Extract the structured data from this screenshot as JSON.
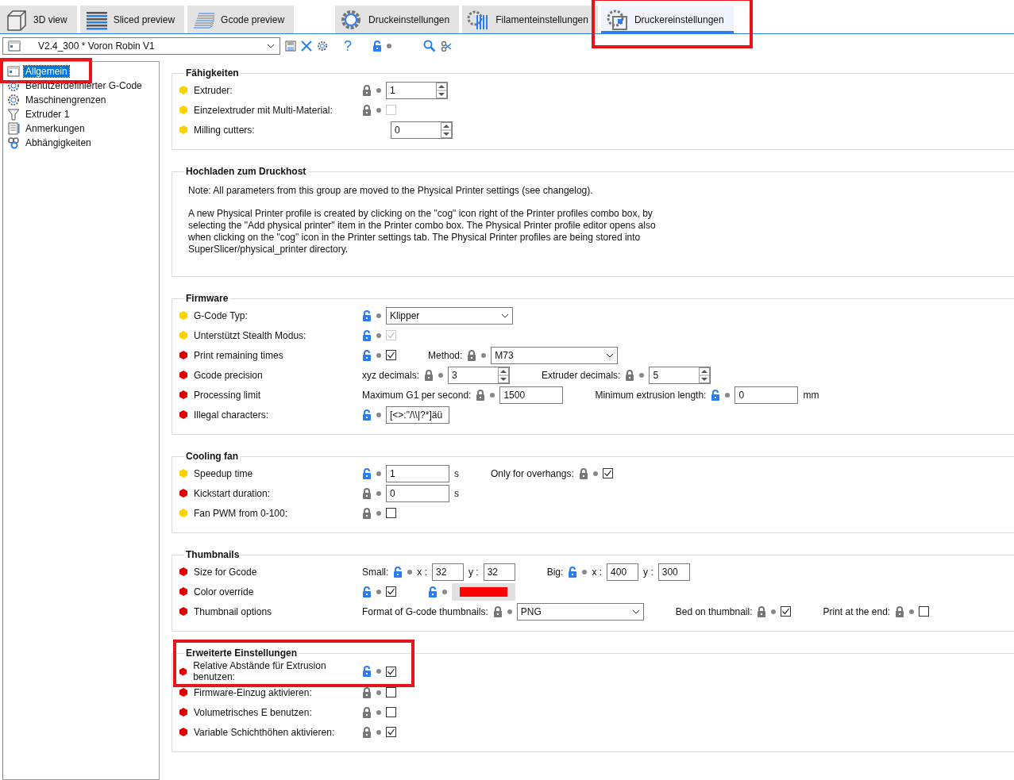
{
  "tabs": {
    "views": [
      {
        "label": "3D view",
        "selected": false
      },
      {
        "label": "Sliced preview",
        "selected": false
      },
      {
        "label": "Gcode preview",
        "selected": false
      }
    ],
    "settings": [
      {
        "label": "Druckeinstellungen",
        "selected": false,
        "highlighted": false
      },
      {
        "label": "Filamenteinstellungen",
        "selected": false,
        "highlighted": false
      },
      {
        "label": "Druckereinstellungen",
        "selected": true,
        "highlighted": true
      }
    ]
  },
  "toolbar": {
    "preset": "V2.4_300 * Voron Robin V1",
    "help": "?"
  },
  "sidebar": {
    "items": [
      {
        "label": "Allgemein",
        "selected": true,
        "highlighted": true
      },
      {
        "label": "Benutzerdefinierter G-Code",
        "selected": false,
        "highlighted": false
      },
      {
        "label": "Maschinengrenzen",
        "selected": false,
        "highlighted": false
      },
      {
        "label": "Extruder 1",
        "selected": false,
        "highlighted": false
      },
      {
        "label": "Anmerkungen",
        "selected": false,
        "highlighted": false
      },
      {
        "label": "Abhängigkeiten",
        "selected": false,
        "highlighted": false
      }
    ]
  },
  "sections": [
    {
      "title": "Fähigkeiten",
      "highlighted": false,
      "rows": [
        {
          "label": "Extruder:",
          "color": "#ffd200",
          "groups": [
            {
              "items": [
                {
                  "kind": "lock",
                  "locked": true
                },
                {
                  "kind": "spin",
                  "value": "1"
                }
              ]
            }
          ]
        },
        {
          "label": "Einzelextruder mit Multi-Material:",
          "color": "#ffd200",
          "groups": [
            {
              "items": [
                {
                  "kind": "lock",
                  "locked": true
                },
                {
                  "kind": "check",
                  "checked": false,
                  "disabled": true
                }
              ]
            }
          ]
        },
        {
          "label": "Milling cutters:",
          "color": "#ffd200",
          "groups": [
            {
              "items": [
                {
                  "kind": "spin",
                  "value": "0"
                }
              ]
            }
          ]
        }
      ]
    },
    {
      "title": "Hochladen zum Druckhost",
      "highlighted": false,
      "paragraphs": [
        "Note: All parameters from this group are moved to the Physical Printer settings (see changelog).",
        "A new Physical Printer profile is created by clicking on the \"cog\" icon right of the Printer profiles combo box, by selecting the \"Add physical printer\" item in the Printer combo box. The Physical Printer profile editor opens also when clicking on the \"cog\" icon in the Printer settings tab. The Physical Printer profiles are being stored into SuperSlicer/physical_printer directory."
      ]
    },
    {
      "title": "Firmware",
      "highlighted": false,
      "rows": [
        {
          "label": "G-Code Typ:",
          "color": "#ffd200",
          "groups": [
            {
              "items": [
                {
                  "kind": "lock",
                  "locked": false
                },
                {
                  "kind": "combo",
                  "value": "Klipper"
                }
              ]
            }
          ]
        },
        {
          "label": "Unterstützt Stealth Modus:",
          "color": "#ffd200",
          "groups": [
            {
              "items": [
                {
                  "kind": "lock",
                  "locked": false
                },
                {
                  "kind": "check",
                  "checked": true,
                  "disabled": true
                }
              ]
            }
          ]
        },
        {
          "label": "Print remaining times",
          "color": "#e00000",
          "groups": [
            {
              "items": [
                {
                  "kind": "lock",
                  "locked": false
                },
                {
                  "kind": "check",
                  "checked": true,
                  "disabled": false
                }
              ]
            },
            {
              "items": [
                {
                  "kind": "label",
                  "text": "Method:"
                },
                {
                  "kind": "lock",
                  "locked": true
                },
                {
                  "kind": "combo",
                  "value": "M73"
                }
              ]
            }
          ]
        },
        {
          "label": "Gcode precision",
          "color": "#e00000",
          "groups": [
            {
              "items": [
                {
                  "kind": "label",
                  "text": "xyz decimals:"
                },
                {
                  "kind": "lock",
                  "locked": true
                },
                {
                  "kind": "spin",
                  "value": "3"
                }
              ]
            },
            {
              "items": [
                {
                  "kind": "label",
                  "text": "Extruder decimals:"
                },
                {
                  "kind": "lock",
                  "locked": true
                },
                {
                  "kind": "spin",
                  "value": "5"
                }
              ]
            }
          ]
        },
        {
          "label": "Processing limit",
          "color": "#e00000",
          "groups": [
            {
              "items": [
                {
                  "kind": "label",
                  "text": "Maximum G1 per second:"
                },
                {
                  "kind": "lock",
                  "locked": true
                },
                {
                  "kind": "text",
                  "value": "1500"
                }
              ]
            },
            {
              "items": [
                {
                  "kind": "label",
                  "text": "Minimum extrusion length:"
                },
                {
                  "kind": "lock",
                  "locked": false
                },
                {
                  "kind": "text",
                  "value": "0"
                },
                {
                  "kind": "unit",
                  "text": "mm"
                }
              ]
            }
          ]
        },
        {
          "label": "Illegal characters:",
          "color": "#e00000",
          "groups": [
            {
              "items": [
                {
                  "kind": "lock",
                  "locked": false
                },
                {
                  "kind": "text",
                  "value": "[<>:\"/\\\\|?*]äü"
                }
              ]
            }
          ]
        }
      ]
    },
    {
      "title": "Cooling fan",
      "highlighted": false,
      "rows": [
        {
          "label": "Speedup time",
          "color": "#ffd200",
          "groups": [
            {
              "items": [
                {
                  "kind": "lock",
                  "locked": false
                },
                {
                  "kind": "text",
                  "value": "1"
                },
                {
                  "kind": "unit",
                  "text": "s"
                }
              ]
            },
            {
              "items": [
                {
                  "kind": "label",
                  "text": "Only for overhangs:"
                },
                {
                  "kind": "lock",
                  "locked": true
                },
                {
                  "kind": "check",
                  "checked": true,
                  "disabled": false
                }
              ]
            }
          ]
        },
        {
          "label": "Kickstart duration:",
          "color": "#e00000",
          "groups": [
            {
              "items": [
                {
                  "kind": "lock",
                  "locked": true
                },
                {
                  "kind": "text",
                  "value": "0"
                },
                {
                  "kind": "unit",
                  "text": "s"
                }
              ]
            }
          ]
        },
        {
          "label": "Fan PWM from 0-100:",
          "color": "#ffd200",
          "groups": [
            {
              "items": [
                {
                  "kind": "lock",
                  "locked": true
                },
                {
                  "kind": "check",
                  "checked": false,
                  "disabled": false
                }
              ]
            }
          ]
        }
      ]
    },
    {
      "title": "Thumbnails",
      "highlighted": false,
      "rows": [
        {
          "label": "Size for Gcode",
          "color": "#e00000",
          "groups": [
            {
              "items": [
                {
                  "kind": "label",
                  "text": "Small:"
                },
                {
                  "kind": "lock",
                  "locked": false
                },
                {
                  "kind": "label",
                  "text": "x :"
                },
                {
                  "kind": "short",
                  "value": "32"
                },
                {
                  "kind": "label",
                  "text": "y :"
                },
                {
                  "kind": "short",
                  "value": "32"
                }
              ]
            },
            {
              "items": [
                {
                  "kind": "label",
                  "text": "Big:"
                },
                {
                  "kind": "lock",
                  "locked": false
                },
                {
                  "kind": "label",
                  "text": "x :"
                },
                {
                  "kind": "short",
                  "value": "400"
                },
                {
                  "kind": "label",
                  "text": "y :"
                },
                {
                  "kind": "short",
                  "value": "300"
                }
              ]
            }
          ]
        },
        {
          "label": "Color override",
          "color": "#e00000",
          "groups": [
            {
              "items": [
                {
                  "kind": "lock",
                  "locked": false
                },
                {
                  "kind": "check",
                  "checked": true,
                  "disabled": false
                }
              ]
            },
            {
              "items": [
                {
                  "kind": "lock",
                  "locked": false
                },
                {
                  "kind": "swatch",
                  "color": "#ff0000"
                }
              ]
            }
          ]
        },
        {
          "label": "Thumbnail options",
          "color": "#e00000",
          "groups": [
            {
              "items": [
                {
                  "kind": "label",
                  "text": "Format of G-code thumbnails:"
                },
                {
                  "kind": "lock",
                  "locked": true
                },
                {
                  "kind": "combo",
                  "value": "PNG"
                }
              ]
            },
            {
              "items": [
                {
                  "kind": "label",
                  "text": "Bed on thumbnail:"
                },
                {
                  "kind": "lock",
                  "locked": true
                },
                {
                  "kind": "check",
                  "checked": true,
                  "disabled": false
                }
              ]
            },
            {
              "items": [
                {
                  "kind": "label",
                  "text": "Print at the end:"
                },
                {
                  "kind": "lock",
                  "locked": true
                },
                {
                  "kind": "check",
                  "checked": false,
                  "disabled": false
                }
              ]
            }
          ]
        }
      ]
    },
    {
      "title": "Erweiterte Einstellungen",
      "highlighted": true,
      "rows": [
        {
          "label": "Relative Abstände für Extrusion benutzen:",
          "color": "#e00000",
          "groups": [
            {
              "items": [
                {
                  "kind": "lock",
                  "locked": false
                },
                {
                  "kind": "check",
                  "checked": true,
                  "disabled": false
                }
              ]
            }
          ]
        },
        {
          "label": "Firmware-Einzug aktivieren:",
          "color": "#e00000",
          "groups": [
            {
              "items": [
                {
                  "kind": "lock",
                  "locked": true
                },
                {
                  "kind": "check",
                  "checked": false,
                  "disabled": false
                }
              ]
            }
          ]
        },
        {
          "label": "Volumetrisches E benutzen:",
          "color": "#e00000",
          "groups": [
            {
              "items": [
                {
                  "kind": "lock",
                  "locked": true
                },
                {
                  "kind": "check",
                  "checked": false,
                  "disabled": false
                }
              ]
            }
          ]
        },
        {
          "label": "Variable Schichthöhen aktivieren:",
          "color": "#e00000",
          "groups": [
            {
              "items": [
                {
                  "kind": "lock",
                  "locked": true
                },
                {
                  "kind": "check",
                  "checked": true,
                  "disabled": false
                }
              ]
            }
          ]
        }
      ]
    }
  ]
}
